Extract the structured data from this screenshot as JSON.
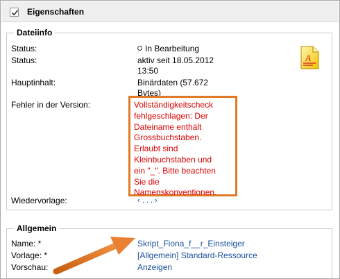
{
  "header": {
    "title": "Eigenschaften"
  },
  "dateiinfo": {
    "legend": "Dateiinfo",
    "status1_label": "Status:",
    "status1_value": "In Bearbeitung",
    "status2_label": "Status:",
    "status2_value_line1": "aktiv seit 18.05.2012",
    "status2_value_line2": "13:50",
    "haupt_label": "Hauptinhalt:",
    "haupt_value_line1": "Binärdaten (57.672",
    "haupt_value_line2": "Bytes)",
    "fehler_label": "Fehler in der Version:",
    "fehler_text": "Vollständigkeitscheck\nfehlgeschlagen: Der\nDateiname enthält\nGrossbuchstaben.\nErlaubt sind\nKleinbuchstaben und\nein \"_\". Bitte beachten\nSie die\nNamenskonventionen.",
    "wieder_label": "Wiedervorlage:",
    "wieder_value": "‹ . . . ›"
  },
  "allgemein": {
    "legend": "Allgemein",
    "name_label": "Name: *",
    "name_value": "Skript_Fiona_f__r_Einsteiger",
    "vorlage_label": "Vorlage: *",
    "vorlage_value": "[Allgemein] Standard-Ressource",
    "vorschau_label": "Vorschau:",
    "vorschau_value": "Anzeigen"
  },
  "colors": {
    "highlight_border": "#e07a26",
    "error_text": "#d80000",
    "link": "#1a4f9c",
    "arrow": "#e07a26"
  },
  "icons": {
    "title": "checkbox-checked-icon",
    "file": "document-file-icon",
    "annotation": "arrow-annotation-icon"
  }
}
